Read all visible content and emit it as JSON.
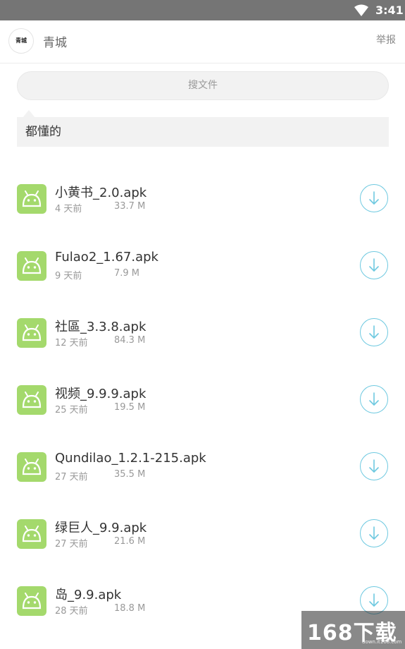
{
  "status_bar": {
    "time": "3:41",
    "icons": [
      "wifi-icon"
    ]
  },
  "header": {
    "avatar_text": "青城",
    "title": "青城",
    "report_label": "举报"
  },
  "search": {
    "label": "搜文件"
  },
  "message": {
    "text": "都懂的"
  },
  "files": [
    {
      "name": "小黄书_2.0.apk",
      "age": "4 天前",
      "size": "33.7 M"
    },
    {
      "name": "Fulao2_1.67.apk",
      "age": "9 天前",
      "size": "7.9 M"
    },
    {
      "name": "社區_3.3.8.apk",
      "age": "12 天前",
      "size": "84.3 M"
    },
    {
      "name": "视频_9.9.9.apk",
      "age": "25 天前",
      "size": "19.5 M"
    },
    {
      "name": "Qundilao_1.2.1-215.apk",
      "age": "27 天前",
      "size": "35.5 M"
    },
    {
      "name": "绿巨人_9.9.apk",
      "age": "27 天前",
      "size": "21.6 M"
    },
    {
      "name": "岛_9.9.apk",
      "age": "28 天前",
      "size": "18.8 M"
    }
  ],
  "watermark": {
    "brand": "168下载",
    "url": "down.it168.com"
  },
  "colors": {
    "apk_green": "#a4d96c",
    "download_blue": "#6ec9e0",
    "status_bar": "#757575"
  },
  "icons": {
    "file": "android-icon",
    "download": "download-icon"
  }
}
